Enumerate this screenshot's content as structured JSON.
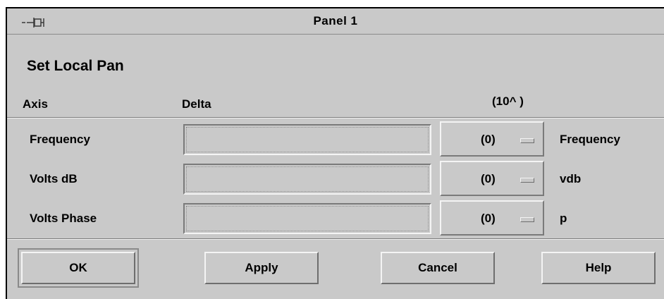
{
  "window": {
    "title": "Panel 1",
    "icon": "pin-icon"
  },
  "panel": {
    "heading": "Set Local Pan",
    "columns": {
      "axis": "Axis",
      "delta": "Delta",
      "exponent": "(10^ )"
    },
    "rows": [
      {
        "label": "Frequency",
        "delta": "",
        "exponent": "(0)",
        "unit": "Frequency"
      },
      {
        "label": "Volts dB",
        "delta": "",
        "exponent": "(0)",
        "unit": "vdb"
      },
      {
        "label": "Volts Phase",
        "delta": "",
        "exponent": "(0)",
        "unit": "p"
      }
    ]
  },
  "buttons": {
    "ok": {
      "mnemonic": "O",
      "rest": "K"
    },
    "apply": {
      "mnemonic": "A",
      "rest": "pply"
    },
    "cancel": {
      "mnemonic": "C",
      "rest": "ancel"
    },
    "help": {
      "mnemonic": "H",
      "rest": "elp"
    }
  },
  "colors": {
    "background": "#c9c9c9",
    "shadow": "#7a7a7a",
    "highlight": "#f4f4f4"
  }
}
